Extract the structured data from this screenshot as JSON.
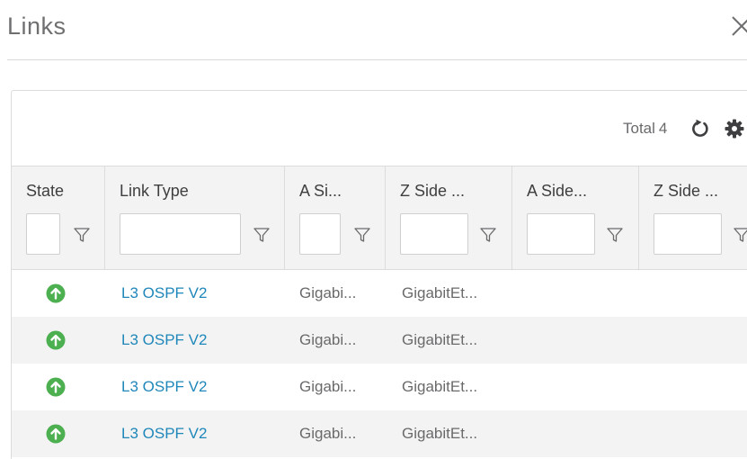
{
  "dialog": {
    "title": "Links"
  },
  "toolbar": {
    "total_label": "Total",
    "total_count": "4"
  },
  "table": {
    "columns": [
      {
        "label": "State"
      },
      {
        "label": "Link Type"
      },
      {
        "label": "A Si..."
      },
      {
        "label": "Z Side ..."
      },
      {
        "label": "A Side..."
      },
      {
        "label": "Z Side ..."
      }
    ],
    "rows": [
      {
        "state": "up",
        "link_type": "L3 OSPF V2",
        "a_side": "Gigabi...",
        "z_side": "GigabitEt..."
      },
      {
        "state": "up",
        "link_type": "L3 OSPF V2",
        "a_side": "Gigabi...",
        "z_side": "GigabitEt..."
      },
      {
        "state": "up",
        "link_type": "L3 OSPF V2",
        "a_side": "Gigabi...",
        "z_side": "GigabitEt..."
      },
      {
        "state": "up",
        "link_type": "L3 OSPF V2",
        "a_side": "Gigabi...",
        "z_side": "GigabitEt..."
      }
    ]
  },
  "colors": {
    "state_up": "#4caf50",
    "link": "#1f87ba",
    "header_bg": "#f3f3f3"
  },
  "icons": {
    "close": "close-icon",
    "refresh": "refresh-icon",
    "settings": "gear-icon",
    "filter": "filter-icon",
    "state_up": "arrow-up-circle-icon"
  }
}
